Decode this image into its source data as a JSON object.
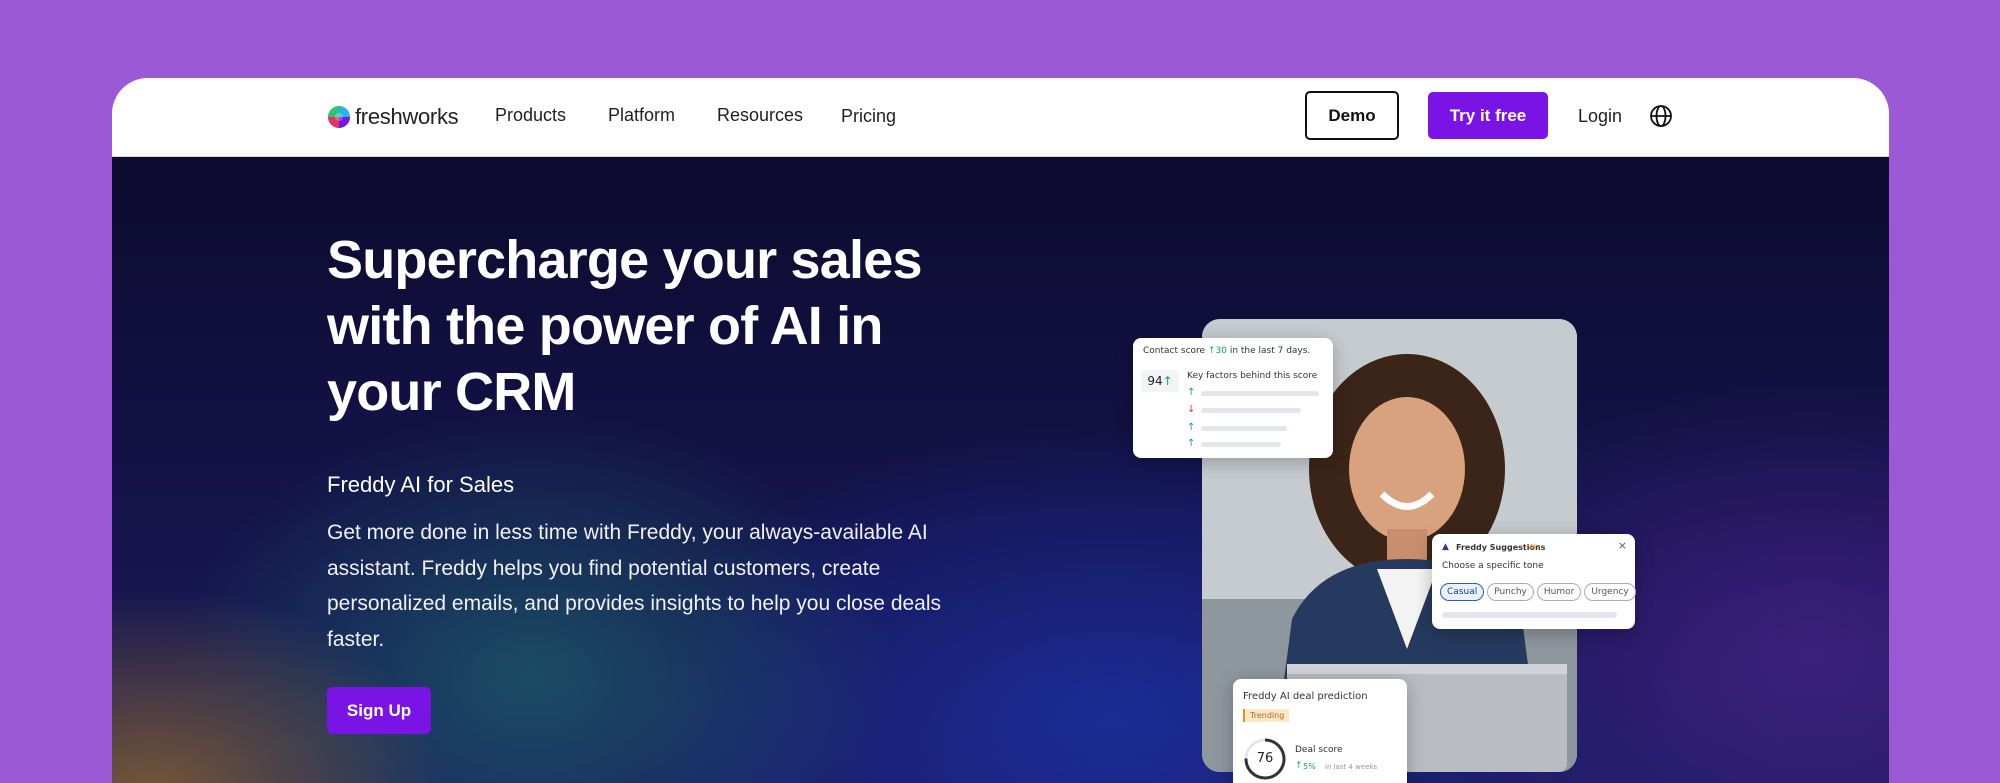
{
  "nav": {
    "logo_text": "freshworks",
    "links": [
      "Products",
      "Platform",
      "Resources",
      "Pricing"
    ],
    "demo_label": "Demo",
    "try_label": "Try it free",
    "login_label": "Login",
    "globe_icon": "globe-icon"
  },
  "hero": {
    "title": "Supercharge your sales with the power of AI in your CRM",
    "subtitle": "Freddy AI for Sales",
    "description": "Get more done in less time with Freddy, your always-available AI assistant. Freddy helps you find potential customers, create personalized emails, and provides insights to help you close deals faster.",
    "cta_label": "Sign Up"
  },
  "contact_card": {
    "title": "Contact score",
    "delta": "30",
    "delta_suffix": "in the last 7 days.",
    "score": "94",
    "factors_title": "Key factors behind this score"
  },
  "suggestions_card": {
    "title": "Freddy Suggestions",
    "badge": "Wiz",
    "prompt": "Choose a specific tone",
    "chips": [
      "Casual",
      "Punchy",
      "Humor",
      "Urgency"
    ],
    "selected_chip": "Casual"
  },
  "deal_card": {
    "title": "Freddy AI deal prediction",
    "tag": "Trending",
    "score": "76",
    "score_label": "Deal score",
    "delta": "5%",
    "delta_suffix": "in last 4 weeks"
  },
  "colors": {
    "page_bg": "#9b59d6",
    "accent": "#7a14e6",
    "hero_dark": "#0d0b2e"
  }
}
